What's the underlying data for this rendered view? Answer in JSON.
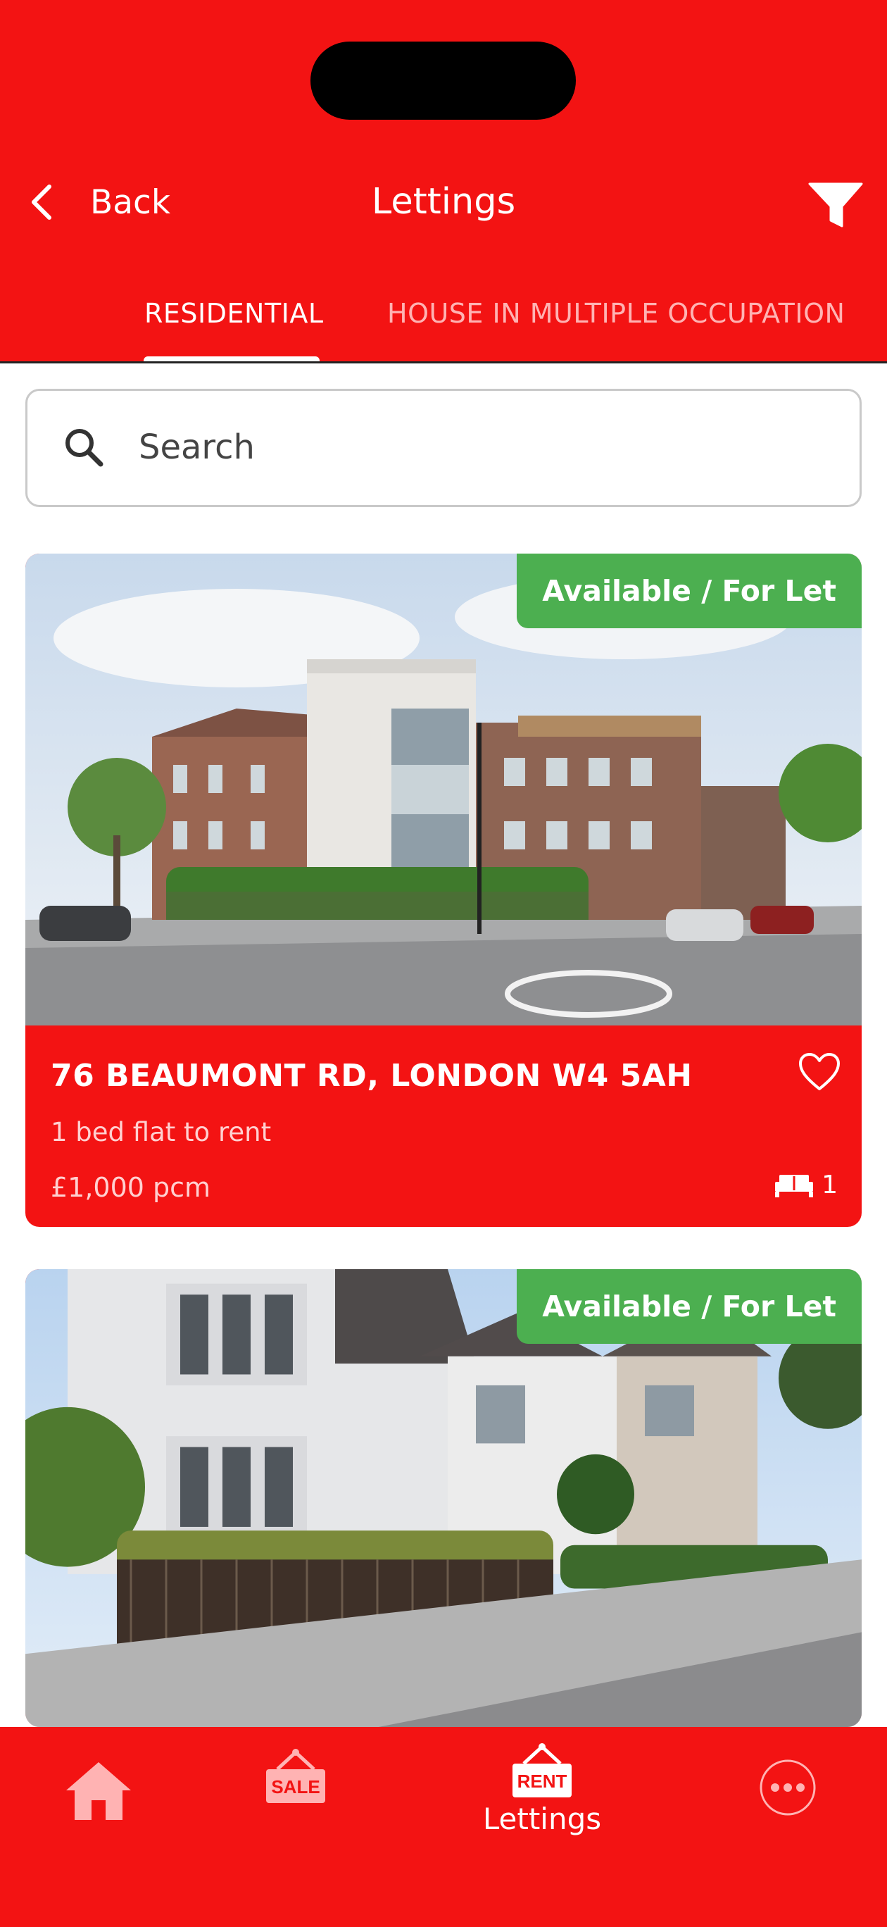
{
  "header": {
    "back_label": "Back",
    "title": "Lettings"
  },
  "tabs": [
    {
      "label": "RESIDENTIAL",
      "active": true
    },
    {
      "label": "HOUSE IN MULTIPLE OCCUPATION",
      "active": false
    }
  ],
  "search": {
    "placeholder": "Search",
    "value": ""
  },
  "listings": [
    {
      "status": "Available / For Let",
      "address": "76 BEAUMONT RD, LONDON W4 5AH",
      "description": "1 bed flat to rent",
      "price": "£1,000 pcm",
      "beds": "1"
    },
    {
      "status": "Available / For Let"
    }
  ],
  "bottom_nav": {
    "items": [
      {
        "icon": "home-icon"
      },
      {
        "icon": "sale-sign-icon",
        "sign": "SALE"
      },
      {
        "icon": "rent-sign-icon",
        "sign": "RENT",
        "label": "Lettings",
        "active": true
      },
      {
        "icon": "more-icon"
      }
    ]
  },
  "colors": {
    "brand": "#f31313",
    "badge": "#4caf50"
  }
}
